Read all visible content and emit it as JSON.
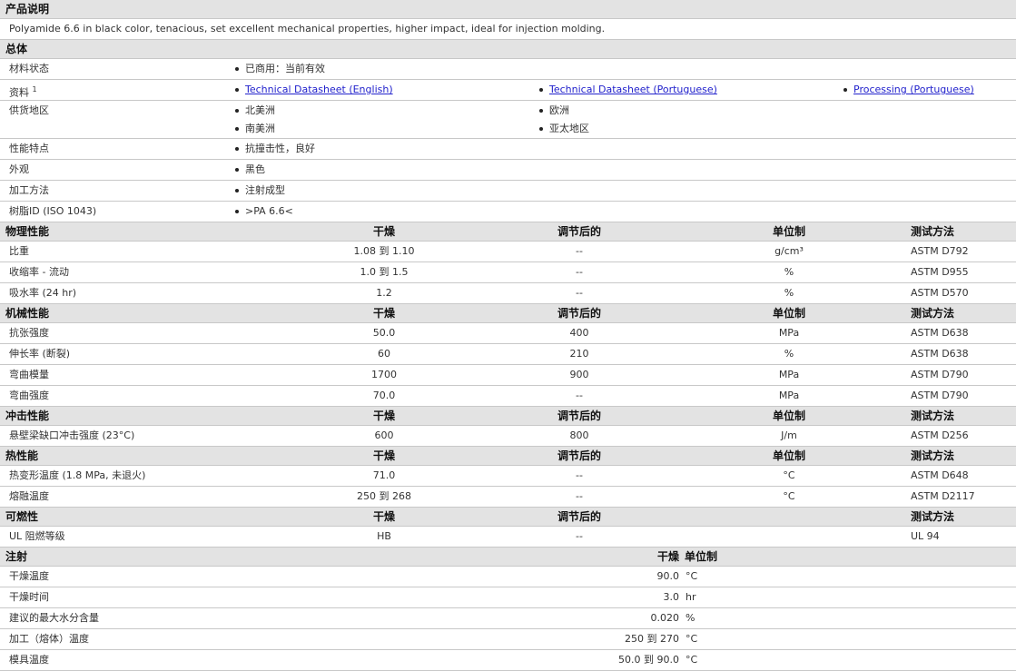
{
  "desc": {
    "title": "产品说明",
    "text": "Polyamide 6.6 in black color, tenacious, set excellent mechanical properties, higher impact, ideal for injection molding."
  },
  "general": {
    "title": "总体",
    "status": {
      "label": "材料状态",
      "value": "已商用：当前有效"
    },
    "docs": {
      "label": "资料",
      "sup": "1",
      "links": [
        "Technical Datasheet (English)",
        "Technical Datasheet (Portuguese)",
        "Processing (Portuguese)"
      ]
    },
    "regions": {
      "label": "供货地区",
      "values": [
        "北美洲",
        "欧洲",
        "南美洲",
        "亚太地区"
      ]
    },
    "features": {
      "label": "性能特点",
      "value": "抗撞击性，良好"
    },
    "appearance": {
      "label": "外观",
      "value": "黑色"
    },
    "method": {
      "label": "加工方法",
      "value": "注射成型"
    },
    "resin": {
      "label": "树脂ID (ISO 1043)",
      "value": ">PA 6.6<"
    }
  },
  "sections": [
    {
      "title": "物理性能",
      "h": [
        "干燥",
        "调节后的",
        "单位制",
        "测试方法"
      ],
      "rows": [
        [
          "比重",
          "1.08 到  1.10",
          "--",
          "g/cm³",
          "ASTM D792"
        ],
        [
          "收缩率  - 流动",
          "1.0 到  1.5",
          "--",
          "%",
          "ASTM D955"
        ],
        [
          "吸水率  (24 hr)",
          "1.2",
          "--",
          "%",
          "ASTM D570"
        ]
      ]
    },
    {
      "title": "机械性能",
      "h": [
        "干燥",
        "调节后的",
        "单位制",
        "测试方法"
      ],
      "rows": [
        [
          "抗张强度",
          "50.0",
          "400",
          "MPa",
          "ASTM D638"
        ],
        [
          "伸长率  (断裂)",
          "60",
          "210",
          "%",
          "ASTM D638"
        ],
        [
          "弯曲模量",
          "1700",
          "900",
          "MPa",
          "ASTM D790"
        ],
        [
          "弯曲强度",
          "70.0",
          "--",
          "MPa",
          "ASTM D790"
        ]
      ]
    },
    {
      "title": "冲击性能",
      "h": [
        "干燥",
        "调节后的",
        "单位制",
        "测试方法"
      ],
      "rows": [
        [
          "悬壁梁缺口冲击强度  (23°C)",
          "600",
          "800",
          "J/m",
          "ASTM D256"
        ]
      ]
    },
    {
      "title": "热性能",
      "h": [
        "干燥",
        "调节后的",
        "单位制",
        "测试方法"
      ],
      "rows": [
        [
          "热变形温度  (1.8 MPa, 未退火)",
          "71.0",
          "--",
          "°C",
          "ASTM D648"
        ],
        [
          "熔融温度",
          "250 到  268",
          "--",
          "°C",
          "ASTM D2117"
        ]
      ]
    },
    {
      "title": "可燃性",
      "h": [
        "干燥",
        "调节后的",
        "",
        "测试方法"
      ],
      "rows": [
        [
          "UL 阻燃等级",
          "HB",
          "--",
          "",
          "UL 94"
        ]
      ]
    }
  ],
  "injection": {
    "title": "注射",
    "h": [
      "干燥",
      "单位制"
    ],
    "rows": [
      [
        "干燥温度",
        "90.0",
        "°C"
      ],
      [
        "干燥时间",
        "3.0",
        "hr"
      ],
      [
        "建议的最大水分含量",
        "0.020",
        "%"
      ],
      [
        "加工（熔体）温度",
        "250 到  270",
        "°C"
      ],
      [
        "模具温度",
        "50.0 到  90.0",
        "°C"
      ]
    ]
  }
}
